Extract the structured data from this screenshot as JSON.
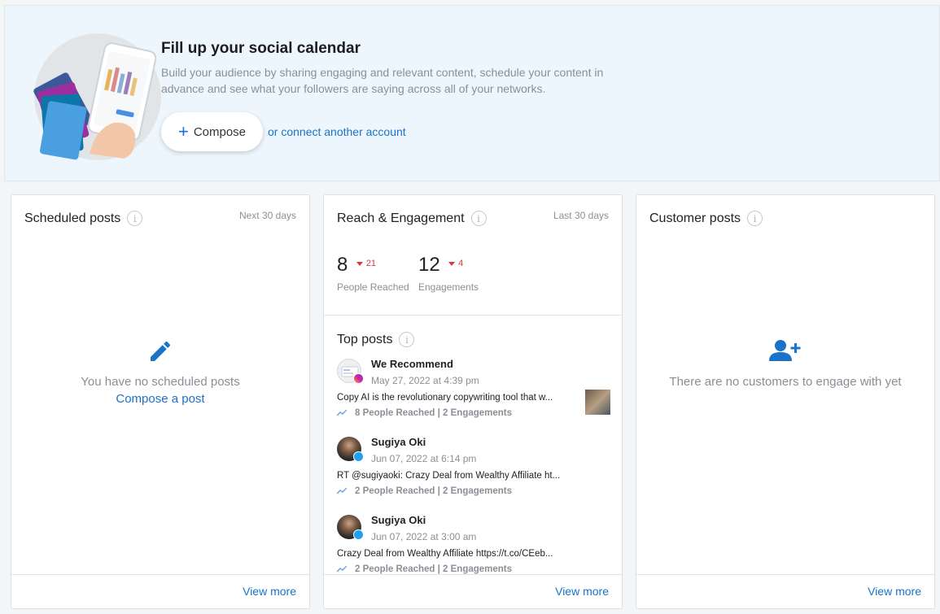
{
  "banner": {
    "title": "Fill up your social calendar",
    "description": "Build your audience by sharing engaging and relevant content, schedule your content in advance and see what your followers are saying across all of your networks.",
    "compose_label": "Compose",
    "connect_link": "or connect another account"
  },
  "scheduled": {
    "title": "Scheduled posts",
    "period": "Next 30 days",
    "empty_text": "You have no scheduled posts",
    "empty_link": "Compose a post",
    "view_more": "View more"
  },
  "reach": {
    "title": "Reach & Engagement",
    "period": "Last 30 days",
    "metrics": [
      {
        "value": "8",
        "delta": "21",
        "label": "People Reached"
      },
      {
        "value": "12",
        "delta": "4",
        "label": "Engagements"
      }
    ],
    "top_title": "Top posts",
    "posts": [
      {
        "name": "We Recommend",
        "date": "May 27, 2022 at 4:39 pm",
        "text": "Copy AI is the revolutionary copywriting tool that w...",
        "stats": "8 People Reached | 2 Engagements",
        "network": "instagram"
      },
      {
        "name": "Sugiya Oki",
        "date": "Jun 07, 2022 at 6:14 pm",
        "text": "RT @sugiyaoki: Crazy Deal from Wealthy Affiliate ht...",
        "stats": "2 People Reached | 2 Engagements",
        "network": "twitter"
      },
      {
        "name": "Sugiya Oki",
        "date": "Jun 07, 2022 at 3:00 am",
        "text": "Crazy Deal from Wealthy Affiliate https://t.co/CEeb...",
        "stats": "2 People Reached | 2 Engagements",
        "network": "twitter"
      }
    ],
    "view_more": "View more"
  },
  "customer": {
    "title": "Customer posts",
    "empty_text": "There are no customers to engage with yet",
    "view_more": "View more"
  },
  "colors": {
    "accent": "#1a73c8",
    "negative": "#d8393c",
    "banner_bg": "#eef6fd"
  }
}
